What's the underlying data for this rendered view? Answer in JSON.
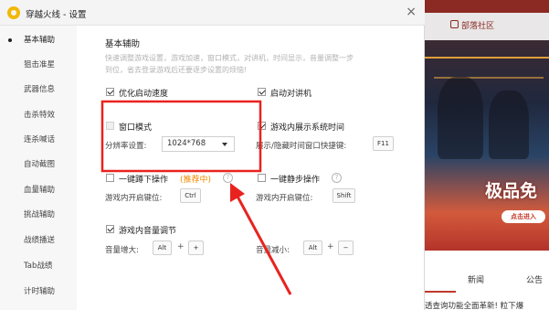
{
  "dialog": {
    "title": "穿越火线 - 设置",
    "close_glyph": "×"
  },
  "sidebar": {
    "items": [
      {
        "label": "基本辅助",
        "active": true
      },
      {
        "label": "狙击准星"
      },
      {
        "label": "武器信息"
      },
      {
        "label": "击杀特效"
      },
      {
        "label": "连杀喊话"
      },
      {
        "label": "自动截图"
      },
      {
        "label": "血量辅助"
      },
      {
        "label": "挑战辅助"
      },
      {
        "label": "战绩播送"
      },
      {
        "label": "Tab战绩"
      },
      {
        "label": "计时辅助"
      }
    ]
  },
  "main": {
    "heading": "基本辅助",
    "desc_line1": "快速调整游戏设置，游戏加速，窗口模式，对讲机，时间显示，音量调整一步",
    "desc_line2": "到位，省去登录游戏后还要逐步设置的烦恼!",
    "opt_startup": {
      "label": "优化启动速度",
      "checked": true
    },
    "opt_intercom": {
      "label": "启动对讲机",
      "checked": true
    },
    "opt_window": {
      "label": "窗口模式",
      "checked": false
    },
    "resolution_label": "分辨率设置:",
    "resolution_value": "1024*768",
    "opt_time": {
      "label": "游戏内展示系统时间",
      "checked": true
    },
    "time_key_label": "展示/隐藏时间窗口快捷键:",
    "time_key": "F11",
    "opt_crouch": {
      "label": "一键蹲下操作",
      "checked": false,
      "badge": "(推荐中)"
    },
    "crouch_key_label": "游戏内开启键位:",
    "crouch_key": "Ctrl",
    "opt_walk": {
      "label": "一键静步操作",
      "checked": false
    },
    "walk_key_label": "游戏内开启键位:",
    "walk_key": "Shift",
    "hint_glyph": "?",
    "opt_volume": {
      "label": "游戏内音量调节",
      "checked": true
    },
    "vol_up_label": "音量增大:",
    "vol_up_mod": "Alt",
    "vol_up_key": "+",
    "vol_down_label": "音量减小:",
    "vol_down_mod": "Alt",
    "vol_down_key": "−",
    "plus_sign": "+"
  },
  "background_app": {
    "community": "部落社区",
    "banner_text": "极品免",
    "banner_button": "点击进入",
    "tab_news": "新闻",
    "tab_notice": "公告",
    "news_snippet": "透查询功能全面革新! 粒下爆"
  },
  "colors": {
    "annotation_red": "#e8231f",
    "accent_orange": "#f08a00",
    "bg_app_brand": "#8a2a23"
  }
}
